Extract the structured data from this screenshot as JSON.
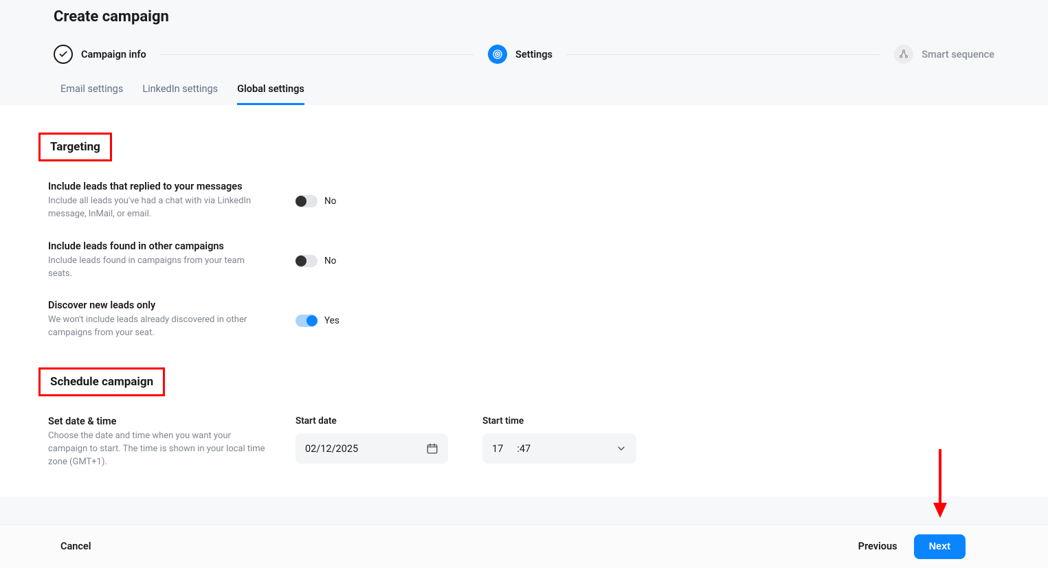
{
  "page": {
    "title": "Create campaign"
  },
  "stepper": {
    "step1": "Campaign info",
    "step2": "Settings",
    "step3": "Smart sequence"
  },
  "tabs": {
    "email": "Email settings",
    "linkedin": "LinkedIn settings",
    "global": "Global settings"
  },
  "targeting": {
    "heading": "Targeting",
    "opt1": {
      "title": "Include leads that replied to your messages",
      "desc": "Include all leads you've had a chat with via LinkedIn message, InMail, or email.",
      "value": "No"
    },
    "opt2": {
      "title": "Include leads found in other campaigns",
      "desc": "Include leads found in campaigns from your team seats.",
      "value": "No"
    },
    "opt3": {
      "title": "Discover new leads only",
      "desc": "We won't include leads already discovered in other campaigns from your seat.",
      "value": "Yes"
    }
  },
  "schedule": {
    "heading": "Schedule campaign",
    "set": {
      "title": "Set date & time",
      "desc": "Choose the date and time when you want your campaign to start. The time is shown in your local time zone (GMT+1)."
    },
    "start_date_label": "Start date",
    "start_date_value": "02/12/2025",
    "start_time_label": "Start time",
    "start_time_hour": "17",
    "start_time_min": ":47"
  },
  "footer": {
    "cancel": "Cancel",
    "previous": "Previous",
    "next": "Next"
  }
}
